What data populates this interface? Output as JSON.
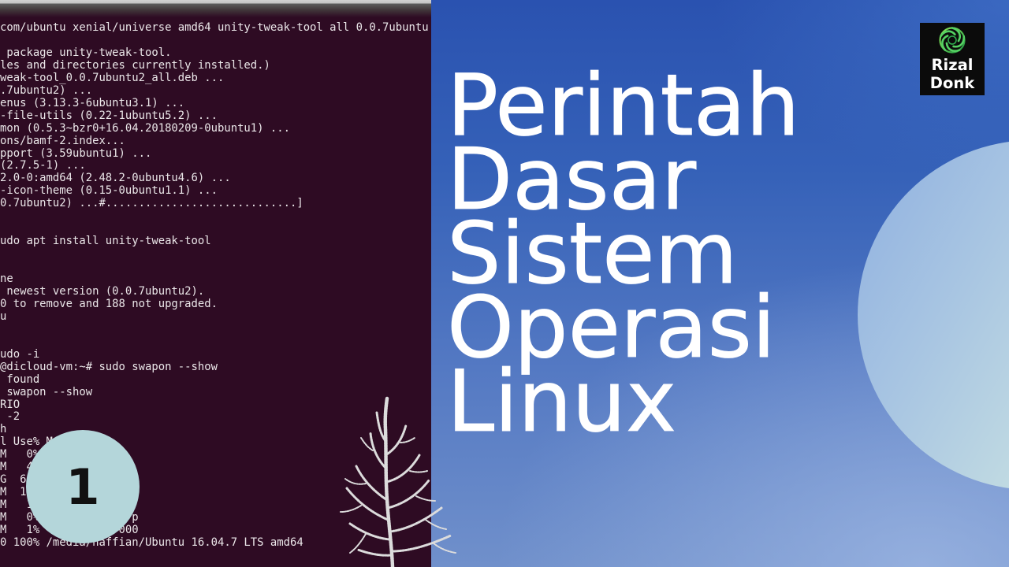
{
  "terminal": {
    "lines": [
      "com/ubuntu xenial/universe amd64 unity-tweak-tool all 0.0.7ubuntu",
      " package unity-tweak-tool.",
      "les and directories currently installed.)",
      "weak-tool_0.0.7ubuntu2_all.deb ...",
      ".7ubuntu2) ...",
      "enus (3.13.3-6ubuntu3.1) ...",
      "-file-utils (0.22-1ubuntu5.2) ...",
      "mon (0.5.3~bzr0+16.04.20180209-0ubuntu1) ...",
      "ons/bamf-2.index...",
      "pport (3.59ubuntu1) ...",
      "(2.7.5-1) ...",
      "2.0-0:amd64 (2.48.2-0ubuntu4.6) ...",
      "-icon-theme (0.15-0ubuntu1.1) ...",
      "0.7ubuntu2) ...#.............................]",
      "udo apt install unity-tweak-tool",
      "ne",
      " newest version (0.0.7ubuntu2).",
      "0 to remove and 188 not upgraded.",
      "u",
      "udo -i",
      "@dicloud-vm:~# sudo swapon --show",
      " found",
      " swapon --show",
      "RIO",
      " -2",
      "h",
      "l Use% M",
      "M   0%",
      "M   4",
      "G  6",
      "M  1",
      "M   1",
      "M   0%              p",
      "M   1%            000",
      "0 100% /media/naffian/Ubuntu 16.04.7 LTS amd64"
    ]
  },
  "headline": [
    "Perintah",
    "Dasar",
    "Sistem",
    "Operasi",
    "Linux"
  ],
  "badge": {
    "number": "1"
  },
  "logo": {
    "line1": "Rizal",
    "line2": "Donk",
    "icon": "swirl-icon"
  },
  "decorations": {
    "illustration": "coral-illustration",
    "shape": "light-circle"
  },
  "colors": {
    "terminal_background": "#2e0b23",
    "terminal_text": "#ebe7e9",
    "panel_top": "#2a52b0",
    "panel_bottom": "#7090cb",
    "circle_light": "#d3e8e1",
    "badge": "#b4d6da",
    "logo_background": "#0b0b0b",
    "logo_icon": "#55d163",
    "headline_text": "#ffffff"
  }
}
